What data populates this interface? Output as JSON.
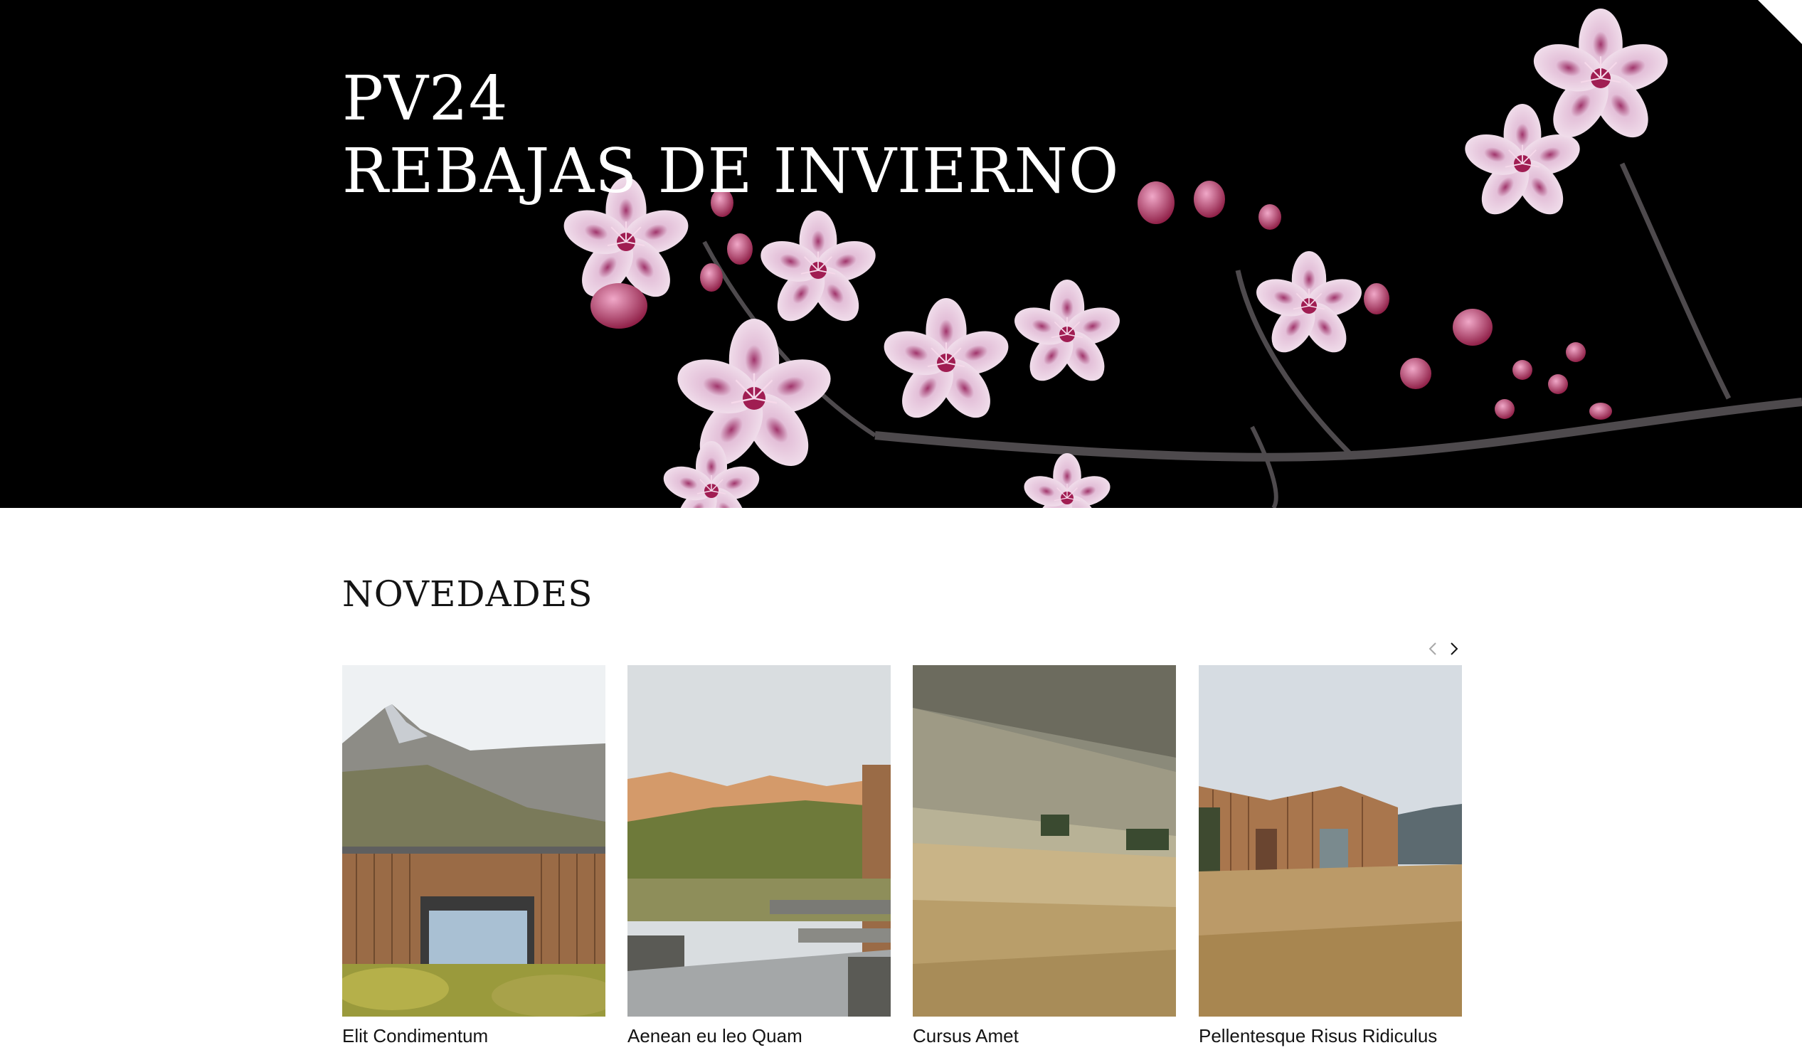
{
  "hero": {
    "title_line1": "PV24",
    "title_line2": "REBAJAS DE INVIERNO",
    "background_color": "#000000",
    "image": "cherry-blossom-branch"
  },
  "new_arrivals": {
    "heading": "NOVEDADES",
    "nav": {
      "prev_icon": "chevron-left-icon",
      "next_icon": "chevron-right-icon"
    },
    "products": [
      {
        "title": "Elit Condimentum",
        "image": "mountain-cabin-large-window"
      },
      {
        "title": "Aenean eu leo Quam",
        "image": "stone-terrace-hills"
      },
      {
        "title": "Cursus Amet",
        "image": "grassy-hillside"
      },
      {
        "title": "Pellentesque Risus Ridiculus",
        "image": "wooden-cabin-meadow"
      }
    ]
  }
}
